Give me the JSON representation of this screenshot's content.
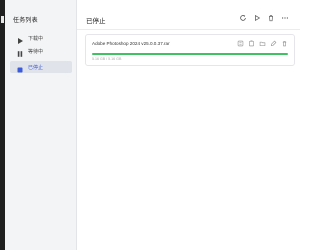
{
  "sidebar": {
    "title": "任务列表",
    "items": [
      {
        "label": "下载中",
        "icon": "play-icon",
        "active": false
      },
      {
        "label": "等待中",
        "icon": "pause-icon",
        "active": false
      },
      {
        "label": "已停止",
        "icon": "stop-icon",
        "active": true
      }
    ]
  },
  "main": {
    "title": "已停止",
    "toolbar": [
      {
        "icon": "refresh-icon"
      },
      {
        "icon": "play-icon"
      },
      {
        "icon": "delete-icon"
      },
      {
        "icon": "more-icon"
      }
    ],
    "tasks": [
      {
        "name": "Adobe Photoshop 2024 v25.0.0.37.rar",
        "progress": 1.0,
        "size_text": "5.16 GB / 5.16 GB",
        "actions": [
          "info-icon",
          "copy-link-icon",
          "open-folder-icon",
          "open-file-icon",
          "delete-icon"
        ]
      }
    ]
  },
  "colors": {
    "accent": "#3b5bdb",
    "progress": "#3ec264",
    "sidebar_bg": "#f3f4f6",
    "titlebar": "#1f1f1f"
  }
}
